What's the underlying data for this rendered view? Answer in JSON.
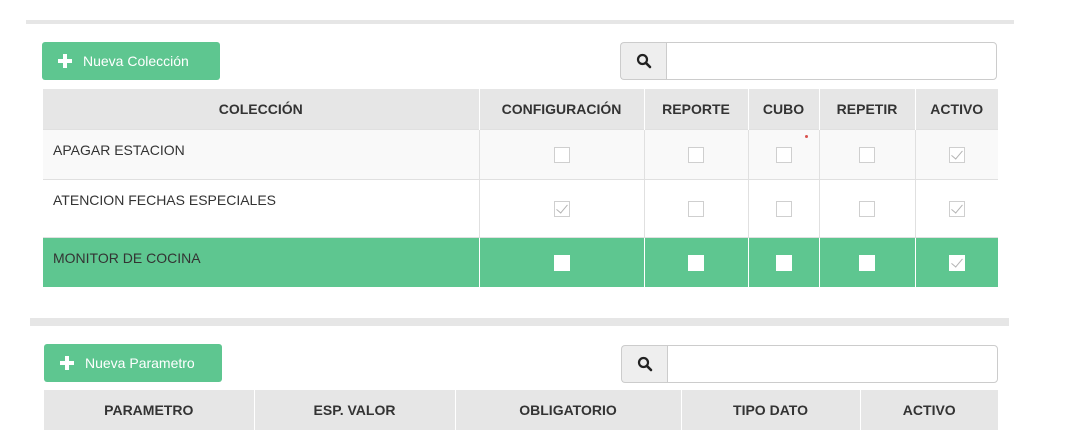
{
  "colecciones": {
    "new_button_label": "Nueva Colección",
    "search": {
      "value": "",
      "placeholder": ""
    },
    "columns": [
      "COLECCIÓN",
      "CONFIGURACIÓN",
      "REPORTE",
      "CUBO",
      "REPETIR",
      "ACTIVO"
    ],
    "rows": [
      {
        "name": "APAGAR ESTACION",
        "configuracion": false,
        "reporte": false,
        "cubo": false,
        "repetir": false,
        "activo": true,
        "selected": false
      },
      {
        "name": "ATENCION FECHAS ESPECIALES",
        "configuracion": true,
        "reporte": false,
        "cubo": false,
        "repetir": false,
        "activo": true,
        "selected": false
      },
      {
        "name": "MONITOR DE COCINA",
        "configuracion": false,
        "reporte": false,
        "cubo": false,
        "repetir": false,
        "activo": true,
        "selected": true
      }
    ]
  },
  "parametros": {
    "new_button_label": "Nueva Parametro",
    "search": {
      "value": "",
      "placeholder": ""
    },
    "columns": [
      "PARAMETRO",
      "ESP. VALOR",
      "OBLIGATORIO",
      "TIPO DATO",
      "ACTIVO"
    ]
  },
  "icons": {
    "search": "search-icon",
    "plus": "plus-icon",
    "checkbox": "checkbox-icon"
  },
  "colors": {
    "accent": "#5ec690",
    "header_bg": "#e6e6e6",
    "divider": "#e6e6e6"
  }
}
